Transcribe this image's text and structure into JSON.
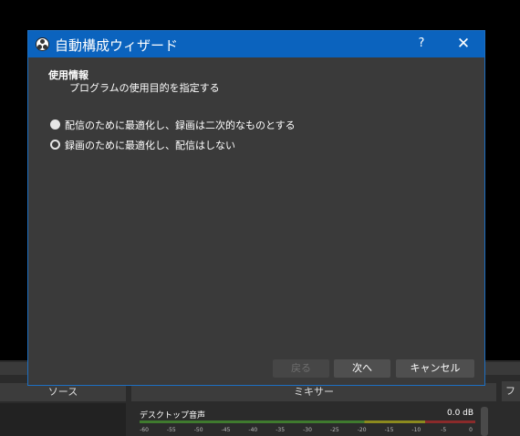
{
  "background": {
    "sources_header": "ソース",
    "mixer_header": "ミキサー",
    "right_button": "フ",
    "mixer_track": {
      "name": "デスクトップ音声",
      "level": "0.0 dB",
      "scale": [
        "-60",
        "-55",
        "-50",
        "-45",
        "-40",
        "-35",
        "-30",
        "-25",
        "-20",
        "-15",
        "-10",
        "-5",
        "0"
      ]
    }
  },
  "dialog": {
    "title": "自動構成ウィザード",
    "help_label": "?",
    "close_label": "✕",
    "section_title": "使用情報",
    "section_subtitle": "プログラムの使用目的を指定する",
    "options": [
      {
        "label": "配信のために最適化し、録画は二次的なものとする",
        "checked": false
      },
      {
        "label": "録画のために最適化し、配信はしない",
        "checked": true
      }
    ],
    "buttons": {
      "back": "戻る",
      "next": "次へ",
      "cancel": "キャンセル"
    }
  },
  "colors": {
    "titlebar": "#0b63be",
    "dialog_bg": "#3a3a3a",
    "accent_border": "#1d6fc2"
  }
}
